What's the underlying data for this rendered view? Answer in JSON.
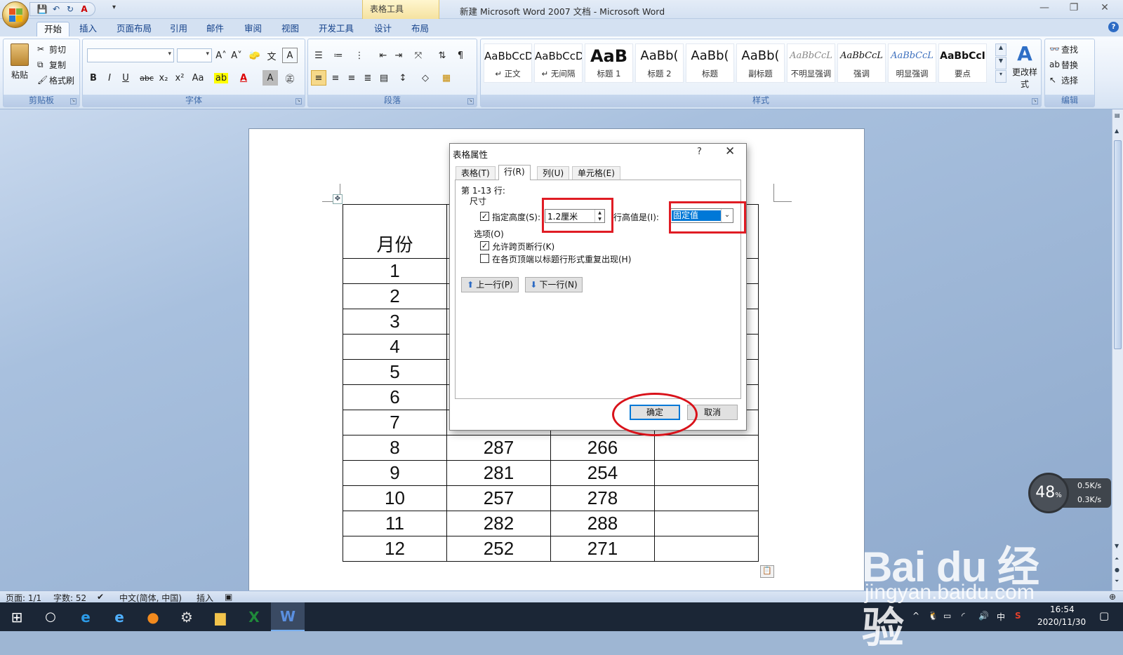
{
  "window": {
    "title": "新建 Microsoft Word 2007 文档 - Microsoft Word",
    "context_group": "表格工具",
    "minimize": "—",
    "restore": "❐",
    "close": "✕"
  },
  "qat": {
    "more": "▾"
  },
  "ribbon": {
    "tabs": [
      "开始",
      "插入",
      "页面布局",
      "引用",
      "邮件",
      "审阅",
      "视图",
      "开发工具",
      "设计",
      "布局"
    ],
    "clipboard": {
      "paste": "粘贴",
      "cut": "剪切",
      "copy": "复制",
      "format_painter": "格式刷",
      "label": "剪贴板"
    },
    "font": {
      "label": "字体",
      "buttons": [
        "B",
        "I",
        "U",
        "abc",
        "x₂",
        "x²",
        "Aa",
        "A",
        "A"
      ],
      "grow": "A˄",
      "shrink": "A˅"
    },
    "paragraph": {
      "label": "段落"
    },
    "styles": {
      "label": "样式",
      "items": [
        {
          "sample": "AaBbCcD",
          "name": "↵ 正文"
        },
        {
          "sample": "AaBbCcD",
          "name": "↵ 无间隔"
        },
        {
          "sample": "AaB",
          "name": "标题 1"
        },
        {
          "sample": "AaBb(",
          "name": "标题 2"
        },
        {
          "sample": "AaBb(",
          "name": "标题"
        },
        {
          "sample": "AaBb(",
          "name": "副标题"
        },
        {
          "sample": "AaBbCcL",
          "name": "不明显强调"
        },
        {
          "sample": "AaBbCcL",
          "name": "强调"
        },
        {
          "sample": "AaBbCcL",
          "name": "明显强调"
        },
        {
          "sample": "AaBbCcI",
          "name": "要点"
        }
      ],
      "change": "更改样式"
    },
    "editing": {
      "label": "编辑",
      "find": "查找",
      "replace": "替换",
      "select": "选择"
    }
  },
  "document": {
    "table": {
      "header": [
        "月份",
        "",
        "",
        ""
      ],
      "rows": [
        [
          "1",
          "",
          "",
          ""
        ],
        [
          "2",
          "",
          "",
          ""
        ],
        [
          "3",
          "",
          "",
          ""
        ],
        [
          "4",
          "",
          "",
          ""
        ],
        [
          "5",
          "",
          "",
          ""
        ],
        [
          "6",
          "",
          "",
          ""
        ],
        [
          "7",
          "",
          "",
          ""
        ],
        [
          "8",
          "287",
          "266",
          ""
        ],
        [
          "9",
          "281",
          "254",
          ""
        ],
        [
          "10",
          "257",
          "278",
          ""
        ],
        [
          "11",
          "282",
          "288",
          ""
        ],
        [
          "12",
          "252",
          "271",
          ""
        ]
      ]
    }
  },
  "dialog": {
    "title": "表格属性",
    "help": "?",
    "close": "✕",
    "tabs": [
      "表格(T)",
      "行(R)",
      "列(U)",
      "单元格(E)"
    ],
    "active_tab": 1,
    "rows_label": "第 1-13 行:",
    "size_label": "尺寸",
    "specify_height_label": "指定高度(S):",
    "specify_height_checked": true,
    "height_value": "1.2厘米",
    "row_height_is_label": "行高值是(I):",
    "row_height_is_value": "固定值",
    "options_label": "选项(O)",
    "allow_break_label": "允许跨页断行(K)",
    "allow_break_checked": true,
    "repeat_header_label": "在各页顶端以标题行形式重复出现(H)",
    "repeat_header_checked": false,
    "prev_row": "上一行(P)",
    "next_row": "下一行(N)",
    "ok": "确定",
    "cancel": "取消"
  },
  "statusbar": {
    "page": "页面: 1/1",
    "words": "字数: 52",
    "language": "中文(简体, 中国)",
    "mode": "插入"
  },
  "taskbar": {
    "time": "16:54",
    "date": "2020/11/30",
    "ime": "中"
  },
  "net_widget": {
    "percent": "48",
    "unit": "%",
    "up": "0.5K/s",
    "down": "0.3K/s"
  },
  "watermark": {
    "brand": "Bai du 经验",
    "url": "jingyan.baidu.com"
  },
  "colors": {
    "accent_red": "#e01c24",
    "selection_blue": "#0078d7",
    "ribbon_blue": "#15428b"
  }
}
